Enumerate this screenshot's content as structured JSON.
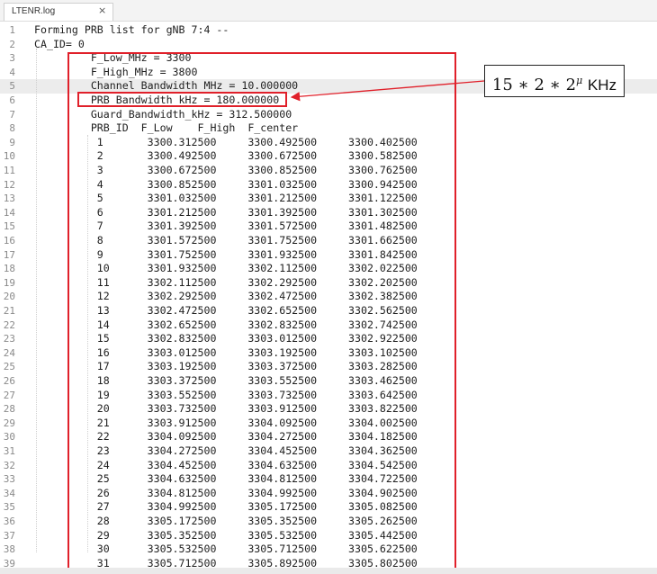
{
  "tab": {
    "title": "LTENR.log",
    "close": "×"
  },
  "lines": [
    {
      "n": "1",
      "text": "Forming PRB list for gNB 7:4 --"
    },
    {
      "n": "2",
      "text": "CA_ID= 0"
    },
    {
      "n": "3",
      "text": "         F_Low_MHz = 3300"
    },
    {
      "n": "4",
      "text": "         F_High_MHz = 3800"
    },
    {
      "n": "5",
      "text": "         Channel Bandwidth MHz = 10.000000"
    },
    {
      "n": "6",
      "text": "         PRB_Bandwidth_kHz = 180.000000"
    },
    {
      "n": "7",
      "text": "         Guard_Bandwidth_kHz = 312.500000"
    },
    {
      "n": "8",
      "text": "         PRB_ID  F_Low    F_High  F_center"
    },
    {
      "n": "9",
      "text": "          1       3300.312500     3300.492500     3300.402500"
    },
    {
      "n": "10",
      "text": "          2       3300.492500     3300.672500     3300.582500"
    },
    {
      "n": "11",
      "text": "          3       3300.672500     3300.852500     3300.762500"
    },
    {
      "n": "12",
      "text": "          4       3300.852500     3301.032500     3300.942500"
    },
    {
      "n": "13",
      "text": "          5       3301.032500     3301.212500     3301.122500"
    },
    {
      "n": "14",
      "text": "          6       3301.212500     3301.392500     3301.302500"
    },
    {
      "n": "15",
      "text": "          7       3301.392500     3301.572500     3301.482500"
    },
    {
      "n": "16",
      "text": "          8       3301.572500     3301.752500     3301.662500"
    },
    {
      "n": "17",
      "text": "          9       3301.752500     3301.932500     3301.842500"
    },
    {
      "n": "18",
      "text": "          10      3301.932500     3302.112500     3302.022500"
    },
    {
      "n": "19",
      "text": "          11      3302.112500     3302.292500     3302.202500"
    },
    {
      "n": "20",
      "text": "          12      3302.292500     3302.472500     3302.382500"
    },
    {
      "n": "21",
      "text": "          13      3302.472500     3302.652500     3302.562500"
    },
    {
      "n": "22",
      "text": "          14      3302.652500     3302.832500     3302.742500"
    },
    {
      "n": "23",
      "text": "          15      3302.832500     3303.012500     3302.922500"
    },
    {
      "n": "24",
      "text": "          16      3303.012500     3303.192500     3303.102500"
    },
    {
      "n": "25",
      "text": "          17      3303.192500     3303.372500     3303.282500"
    },
    {
      "n": "26",
      "text": "          18      3303.372500     3303.552500     3303.462500"
    },
    {
      "n": "27",
      "text": "          19      3303.552500     3303.732500     3303.642500"
    },
    {
      "n": "28",
      "text": "          20      3303.732500     3303.912500     3303.822500"
    },
    {
      "n": "29",
      "text": "          21      3303.912500     3304.092500     3304.002500"
    },
    {
      "n": "30",
      "text": "          22      3304.092500     3304.272500     3304.182500"
    },
    {
      "n": "31",
      "text": "          23      3304.272500     3304.452500     3304.362500"
    },
    {
      "n": "32",
      "text": "          24      3304.452500     3304.632500     3304.542500"
    },
    {
      "n": "33",
      "text": "          25      3304.632500     3304.812500     3304.722500"
    },
    {
      "n": "34",
      "text": "          26      3304.812500     3304.992500     3304.902500"
    },
    {
      "n": "35",
      "text": "          27      3304.992500     3305.172500     3305.082500"
    },
    {
      "n": "36",
      "text": "          28      3305.172500     3305.352500     3305.262500"
    },
    {
      "n": "37",
      "text": "          29      3305.352500     3305.532500     3305.442500"
    },
    {
      "n": "38",
      "text": "          30      3305.532500     3305.712500     3305.622500"
    },
    {
      "n": "39",
      "text": "          31      3305.712500     3305.892500     3305.802500"
    }
  ],
  "current_line": "5",
  "annotation": {
    "formula": "15 ∗ 2 ∗ 2",
    "exponent": "μ",
    "unit": "KHz",
    "color": "#e0202a"
  }
}
